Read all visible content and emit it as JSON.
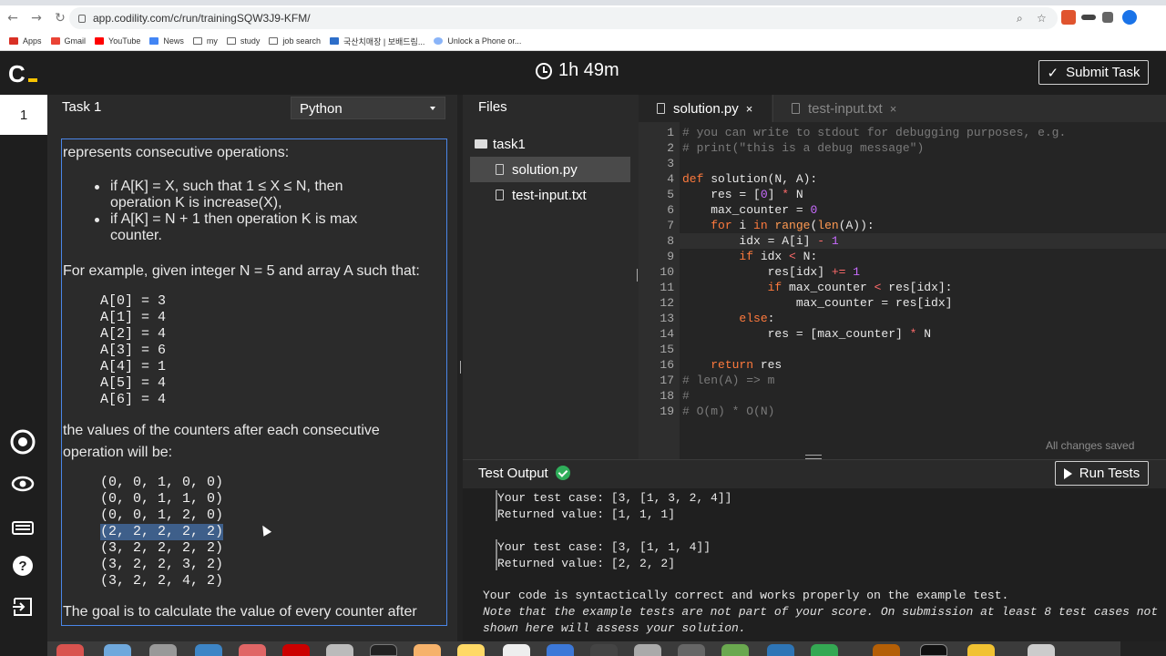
{
  "browser": {
    "url": "app.codility.com/c/run/trainingSQW3J9-KFM/",
    "bookmarks": [
      "Apps",
      "Gmail",
      "YouTube",
      "News",
      "my",
      "study",
      "job search",
      "국산치매장 | 보배드림...",
      "Unlock a Phone or..."
    ]
  },
  "header": {
    "logo": "C",
    "timer": "1h 49m",
    "submit_label": "Submit Task"
  },
  "rail": {
    "task_number": "1",
    "icons": [
      "settings-icon",
      "eye-icon",
      "keyboard-icon",
      "help-icon",
      "exit-icon"
    ]
  },
  "task": {
    "title": "Task 1",
    "language": "Python",
    "text": {
      "intro": "represents consecutive operations:",
      "bullet1_line1": "if A[K] = X, such that 1 ≤ X ≤ N, then",
      "bullet1_line2": "operation K is increase(X),",
      "bullet2_line1": "if A[K] = N + 1 then operation K is max",
      "bullet2_line2": "counter.",
      "example_intro": "For example, given integer N = 5 and array A such that:",
      "array_lines": [
        "A[0] = 3",
        "A[1] = 4",
        "A[2] = 4",
        "A[3] = 6",
        "A[4] = 1",
        "A[5] = 4",
        "A[6] = 4"
      ],
      "counters_intro_1": "the values of the counters after each consecutive",
      "counters_intro_2": "operation will be:",
      "counter_lines": [
        "(0, 0, 1, 0, 0)",
        "(0, 0, 1, 1, 0)",
        "(0, 0, 1, 2, 0)",
        "(2, 2, 2, 2, 2)",
        "(3, 2, 2, 2, 2)",
        "(3, 2, 2, 3, 2)",
        "(3, 2, 2, 4, 2)"
      ],
      "goal": "The goal is to calculate the value of every counter after"
    }
  },
  "files": {
    "title": "Files",
    "folder": "task1",
    "items": [
      "solution.py",
      "test-input.txt"
    ],
    "selected": "solution.py"
  },
  "editor": {
    "tabs": [
      {
        "label": "solution.py",
        "close": "×"
      },
      {
        "label": "test-input.txt",
        "close": "×"
      }
    ],
    "saved_status": "All changes saved",
    "code_lines": [
      "# you can write to stdout for debugging purposes, e.g.",
      "# print(\"this is a debug message\")",
      "",
      "def solution(N, A):",
      "    res = [0] * N",
      "    max_counter = 0",
      "    for i in range(len(A)):",
      "        idx = A[i] - 1",
      "        if idx < N:",
      "            res[idx] += 1",
      "            if max_counter < res[idx]:",
      "                max_counter = res[idx]",
      "        else:",
      "            res = [max_counter] * N",
      "",
      "    return res",
      "# len(A) => m",
      "#",
      "# O(m) * O(N)"
    ]
  },
  "output": {
    "title": "Test Output",
    "run_label": "Run Tests",
    "case1_input": "Your test case: [3, [1, 3, 2, 4]]",
    "case1_result": "Returned value: [1, 1, 1]",
    "case2_input": "Your test case: [3, [1, 1, 4]]",
    "case2_result": "Returned value: [2, 2, 2]",
    "summary": "Your code is syntactically correct and works properly on the example test.",
    "note_1": "Note that the example tests are not part of your score. On submission at least 8 test cases not",
    "note_2": "shown here will assess your solution."
  },
  "colors": {
    "accent": "#f8c300",
    "selection_border": "#4a86e8",
    "success": "#2fae5a",
    "keyword": "#ff7a3d",
    "number": "#c96cff"
  }
}
